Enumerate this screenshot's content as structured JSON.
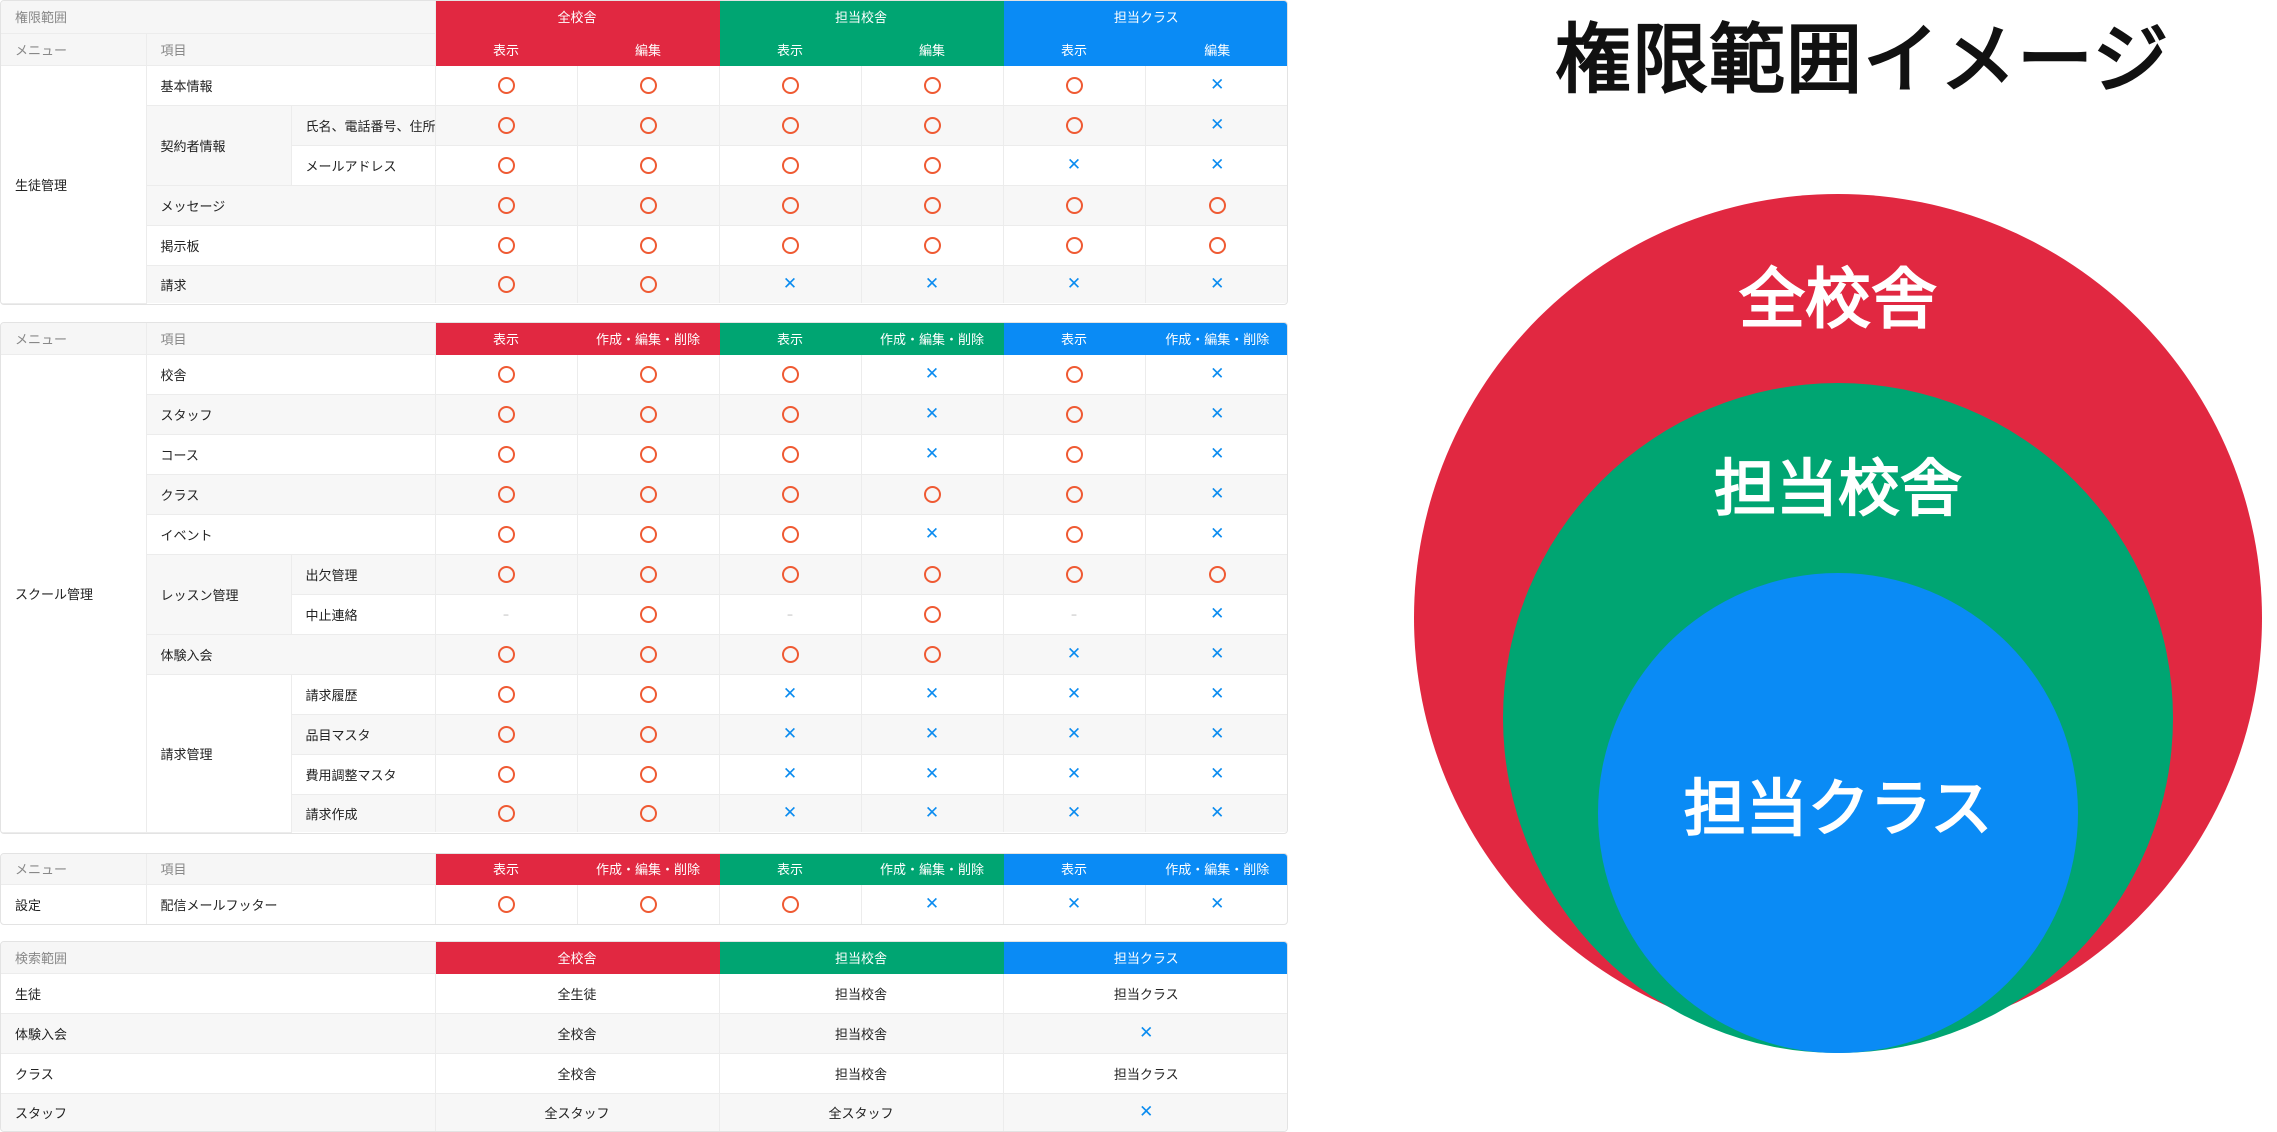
{
  "marks": {
    "o": "circle-mark",
    "x": "cross-mark",
    "-": "–"
  },
  "colors": {
    "all": "#e12841",
    "assigned_school": "#00a572",
    "assigned_class": "#0a8bf5",
    "circle": "#ef5a33",
    "cross": "#0b8cf0"
  },
  "table1": {
    "corner_label": "権限範囲",
    "col_labels": [
      "メニュー",
      "項目"
    ],
    "groups": [
      "全校舎",
      "担当校舎",
      "担当クラス"
    ],
    "sub": [
      "表示",
      "編集",
      "表示",
      "編集",
      "表示",
      "編集"
    ],
    "menu": "生徒管理",
    "rows": [
      {
        "item": "基本情報",
        "sub": "",
        "marks": [
          "o",
          "o",
          "o",
          "o",
          "o",
          "x"
        ]
      },
      {
        "item": "契約者情報",
        "sub": "氏名、電話番号、住所",
        "marks": [
          "o",
          "o",
          "o",
          "o",
          "o",
          "x"
        ]
      },
      {
        "item": "",
        "sub": "メールアドレス",
        "marks": [
          "o",
          "o",
          "o",
          "o",
          "x",
          "x"
        ]
      },
      {
        "item": "メッセージ",
        "sub": "",
        "marks": [
          "o",
          "o",
          "o",
          "o",
          "o",
          "o"
        ]
      },
      {
        "item": "掲示板",
        "sub": "",
        "marks": [
          "o",
          "o",
          "o",
          "o",
          "o",
          "o"
        ]
      },
      {
        "item": "請求",
        "sub": "",
        "marks": [
          "o",
          "o",
          "x",
          "x",
          "x",
          "x"
        ]
      }
    ]
  },
  "table2": {
    "col_labels": [
      "メニュー",
      "項目"
    ],
    "sub": [
      "表示",
      "作成・編集・削除",
      "表示",
      "作成・編集・削除",
      "表示",
      "作成・編集・削除"
    ],
    "menu": "スクール管理",
    "rows": [
      {
        "item": "校舎",
        "sub": "",
        "marks": [
          "o",
          "o",
          "o",
          "x",
          "o",
          "x"
        ]
      },
      {
        "item": "スタッフ",
        "sub": "",
        "marks": [
          "o",
          "o",
          "o",
          "x",
          "o",
          "x"
        ]
      },
      {
        "item": "コース",
        "sub": "",
        "marks": [
          "o",
          "o",
          "o",
          "x",
          "o",
          "x"
        ]
      },
      {
        "item": "クラス",
        "sub": "",
        "marks": [
          "o",
          "o",
          "o",
          "o",
          "o",
          "x"
        ]
      },
      {
        "item": "イベント",
        "sub": "",
        "marks": [
          "o",
          "o",
          "o",
          "x",
          "o",
          "x"
        ]
      },
      {
        "item": "レッスン管理",
        "sub": "出欠管理",
        "marks": [
          "o",
          "o",
          "o",
          "o",
          "o",
          "o"
        ]
      },
      {
        "item": "",
        "sub": "中止連絡",
        "marks": [
          "-",
          "o",
          "-",
          "o",
          "-",
          "x"
        ]
      },
      {
        "item": "体験入会",
        "sub": "",
        "marks": [
          "o",
          "o",
          "o",
          "o",
          "x",
          "x"
        ]
      },
      {
        "item": "請求管理",
        "sub": "請求履歴",
        "marks": [
          "o",
          "o",
          "x",
          "x",
          "x",
          "x"
        ]
      },
      {
        "item": "",
        "sub": "品目マスタ",
        "marks": [
          "o",
          "o",
          "x",
          "x",
          "x",
          "x"
        ]
      },
      {
        "item": "",
        "sub": "費用調整マスタ",
        "marks": [
          "o",
          "o",
          "x",
          "x",
          "x",
          "x"
        ]
      },
      {
        "item": "",
        "sub": "請求作成",
        "marks": [
          "o",
          "o",
          "x",
          "x",
          "x",
          "x"
        ]
      }
    ]
  },
  "table3": {
    "col_labels": [
      "メニュー",
      "項目"
    ],
    "sub": [
      "表示",
      "作成・編集・削除",
      "表示",
      "作成・編集・削除",
      "表示",
      "作成・編集・削除"
    ],
    "menu": "設定",
    "rows": [
      {
        "item": "配信メールフッター",
        "sub": "",
        "marks": [
          "o",
          "o",
          "o",
          "x",
          "x",
          "x"
        ]
      }
    ]
  },
  "table4": {
    "corner_label": "検索範囲",
    "groups": [
      "全校舎",
      "担当校舎",
      "担当クラス"
    ],
    "rows": [
      {
        "label": "生徒",
        "values": [
          "全生徒",
          "担当校舎",
          "担当クラス"
        ]
      },
      {
        "label": "体験入会",
        "values": [
          "全校舎",
          "担当校舎",
          "x"
        ]
      },
      {
        "label": "クラス",
        "values": [
          "全校舎",
          "担当校舎",
          "担当クラス"
        ]
      },
      {
        "label": "スタッフ",
        "values": [
          "全スタッフ",
          "全スタッフ",
          "x"
        ]
      }
    ]
  },
  "venn": {
    "title": "権限範囲イメージ",
    "labels": [
      "全校舎",
      "担当校舎",
      "担当クラス"
    ]
  }
}
